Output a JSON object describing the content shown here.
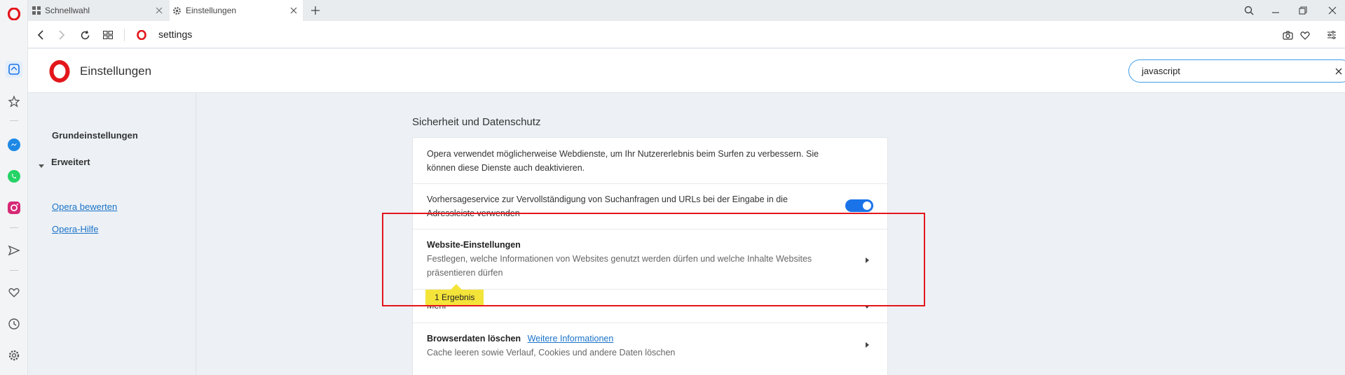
{
  "tabs": [
    {
      "label": "Schnellwahl",
      "icon": "grid-icon",
      "active": false
    },
    {
      "label": "Einstellungen",
      "icon": "gear-icon",
      "active": true
    }
  ],
  "addressbar": {
    "url": "settings"
  },
  "header": {
    "title": "Einstellungen"
  },
  "search": {
    "value": "javascript"
  },
  "nav": {
    "basic": "Grundeinstellungen",
    "advanced": "Erweitert",
    "rate": "Opera bewerten",
    "help": "Opera-Hilfe"
  },
  "section": {
    "title": "Sicherheit und Datenschutz"
  },
  "rows": {
    "intro": "Opera verwendet möglicherweise Webdienste, um Ihr Nutzererlebnis beim Surfen zu verbessern. Sie können diese Dienste auch deaktivieren.",
    "prediction": "Vorhersageservice zur Vervollständigung von Suchanfragen und URLs bei der Eingabe in die Adressleiste verwenden",
    "site_settings_title": "Website-Einstellungen",
    "site_settings_desc": "Festlegen, welche Informationen von Websites genutzt werden dürfen und welche Inhalte Websites präsentieren dürfen",
    "more": "Mehr",
    "clear_title": "Browserdaten löschen",
    "clear_more": "Weitere Informationen",
    "clear_desc": "Cache leeren sowie Verlauf, Cookies und andere Daten löschen"
  },
  "badge": {
    "label": "1 Ergebnis"
  },
  "toggle": {
    "prediction_on": true
  },
  "colors": {
    "accent": "#1a73e8",
    "opera_red": "#e3161b",
    "highlight": "#f4e43a",
    "annotation": "#e3161b"
  }
}
